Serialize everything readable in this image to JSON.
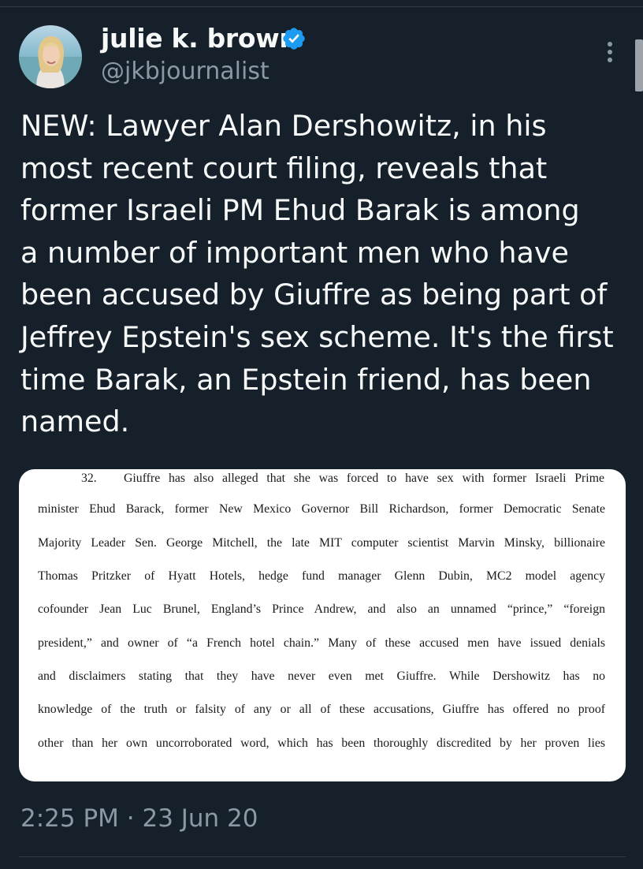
{
  "author": {
    "display_name": "julie k. brown",
    "handle": "@jkbjournalist",
    "verified": true,
    "avatar_icon": "profile-photo"
  },
  "tweet": {
    "lines": [
      "NEW: Lawyer Alan Dershowitz, in his",
      "most recent court filing, reveals that",
      "former Israeli PM Ehud Barak is among",
      "a number of important men who have",
      "been accused by Giuffre as being part of",
      "Jeffrey Epstein's sex scheme. It's the first",
      "time Barak, an Epstein friend, has been",
      "named."
    ]
  },
  "document": {
    "paragraph_number": "32.",
    "lines": [
      "Giuffre has also alleged that she was forced to have sex with former Israeli Prime",
      "minister Ehud Barack, former New Mexico Governor Bill Richardson, former Democratic Senate",
      "Majority Leader Sen. George Mitchell, the late MIT computer scientist Marvin Minsky, billionaire",
      "Thomas Pritzker of Hyatt Hotels, hedge fund manager Glenn Dubin, MC2 model agency",
      "cofounder Jean Luc Brunel, England’s Prince Andrew, and also an unnamed “prince,” “foreign",
      "president,” and owner of “a French hotel chain.”  Many of these accused men have issued denials",
      "and disclaimers stating that they have never even met Giuffre.   While Dershowitz has no",
      "knowledge of the truth or falsity of any or all of these accusations, Giuffre has offered no proof",
      "other than her own uncorroborated word, which has been thoroughly discredited by her proven lies"
    ]
  },
  "timestamp": "2:25 PM · 23 Jun 20",
  "colors": {
    "background": "#15202b",
    "primary_text": "#f7f9f9",
    "secondary_text": "#8b98a5",
    "verified_badge": "#1d9bf0"
  },
  "icons": {
    "verified": "verified-badge-icon",
    "more": "more-options-icon"
  }
}
